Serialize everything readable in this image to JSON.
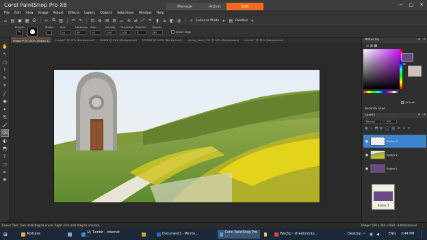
{
  "app": {
    "title": "Corel PaintShop Pro X8",
    "mode_tabs": [
      {
        "label": "Manage",
        "active": false
      },
      {
        "label": "Adjust",
        "active": false
      },
      {
        "label": "Edit",
        "active": true
      }
    ],
    "window_controls": [
      "−",
      "□",
      "✕"
    ]
  },
  "menu": [
    "File",
    "Edit",
    "View",
    "Image",
    "Adjust",
    "Effects",
    "Layers",
    "Objects",
    "Selections",
    "Window",
    "Help"
  ],
  "toolbar": {
    "enhance_label": "Enhance Photo",
    "palettes_label": "Palettes"
  },
  "tool_options": {
    "labels": [
      "Presets",
      "Shape",
      "Size",
      "Hardness",
      "Step",
      "Density",
      "Thickness",
      "Rotation",
      "Opacity"
    ],
    "values": [
      "",
      "",
      "24",
      "50",
      "25",
      "100",
      "100",
      "0",
      "50"
    ],
    "smart_edge_label": "Smart Edge"
  },
  "tools": [
    {
      "name": "pan-tool-icon",
      "glyph": "✋"
    },
    {
      "name": "pick-tool-icon",
      "glyph": "↖"
    },
    {
      "name": "selection-tool-icon",
      "glyph": "▢"
    },
    {
      "name": "freehand-selection-icon",
      "glyph": "⌇"
    },
    {
      "name": "eyedropper-icon",
      "glyph": "✎"
    },
    {
      "name": "crop-tool-icon",
      "glyph": "⌗"
    },
    {
      "name": "straighten-tool-icon",
      "glyph": "╱"
    },
    {
      "name": "red-eye-tool-icon",
      "glyph": "◉"
    },
    {
      "name": "makeover-tool-icon",
      "glyph": "✦"
    },
    {
      "name": "clone-tool-icon",
      "glyph": "⎘"
    },
    {
      "name": "paint-brush-icon",
      "glyph": "🖌"
    },
    {
      "name": "eraser-tool-icon",
      "glyph": "⌫",
      "active": true
    },
    {
      "name": "dodge-tool-icon",
      "glyph": "◐"
    },
    {
      "name": "fill-tool-icon",
      "glyph": "⬒"
    },
    {
      "name": "text-tool-icon",
      "glyph": "T"
    },
    {
      "name": "preset-shape-icon",
      "glyph": "▭"
    },
    {
      "name": "pen-tool-icon",
      "glyph": "✒"
    },
    {
      "name": "warp-brush-icon",
      "glyph": "❋"
    }
  ],
  "doc_tabs": [
    {
      "label": "Image1* @ 200% (Raster 1)",
      "active": true
    },
    {
      "label": "Image2* @ 25% (Background)",
      "active": false
    },
    {
      "label": "DOWN @ 51% (Background)",
      "active": false
    },
    {
      "label": "DOWN2 @ 100% (Background)",
      "active": false
    },
    {
      "label": "spring_stock_011 @ 18% (Background)",
      "active": false
    },
    {
      "label": "street1* @ 34% (Background)",
      "active": false
    }
  ],
  "panels": {
    "materials": {
      "title": "Materials",
      "all_tools_label": "All tools"
    },
    "recently_used": {
      "title": "Recently Used"
    },
    "layers": {
      "title": "Layers",
      "blend_mode": "Normal",
      "opacity": "100",
      "rows": [
        {
          "name": "Raster 3",
          "active": true
        },
        {
          "name": "Raster 2",
          "active": false
        },
        {
          "name": "Raster 1",
          "active": false
        }
      ],
      "preview_label": "Raster 1"
    }
  },
  "status": {
    "text": "Eraser Tool: Click and drag to erase. Right click and drag to unerase.",
    "image_info": "Image: 500 x 250 x RGB - 8 bits/channel"
  },
  "taskbar": {
    "items": [
      {
        "label": "Textures",
        "color": "#e8b13a",
        "active": false
      },
      {
        "label": "",
        "color": "#7aa6d8",
        "active": false
      },
      {
        "label": "(2) Tumblr - Internet ...",
        "color": "#3c8dde",
        "active": false
      },
      {
        "label": "",
        "color": "#d8a030",
        "active": false
      },
      {
        "label": "Document1 - Micros...",
        "color": "#2f66c0",
        "active": false
      },
      {
        "label": "Corel PaintShop Pro ...",
        "color": "#47a6d9",
        "active": true
      },
      {
        "label": "",
        "color": "#f0c040",
        "active": false
      },
      {
        "label": "WinZip - streetstocks...",
        "color": "#d44",
        "active": false
      }
    ],
    "desktop_label": "Desktop",
    "language": "ENG",
    "time": "3:44 PM"
  },
  "colors": {
    "accent": "#f26a1b",
    "layer_selected": "#3d84cf",
    "foreground_swatch": "#6a4a86",
    "background_swatch": "#cec2b6"
  }
}
